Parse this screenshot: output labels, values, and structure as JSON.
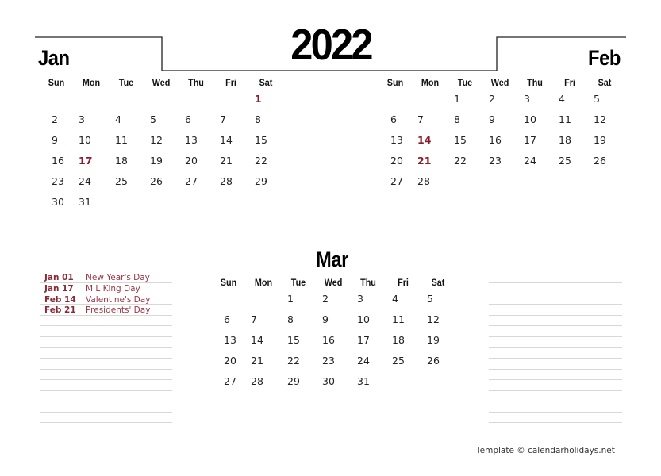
{
  "year": "2022",
  "weekdays": [
    "Sun",
    "Mon",
    "Tue",
    "Wed",
    "Thu",
    "Fri",
    "Sat"
  ],
  "months": [
    {
      "name": "Jan",
      "weeks": [
        [
          "",
          "",
          "",
          "",
          "",
          "",
          "1"
        ],
        [
          "2",
          "3",
          "4",
          "5",
          "6",
          "7",
          "8"
        ],
        [
          "9",
          "10",
          "11",
          "12",
          "13",
          "14",
          "15"
        ],
        [
          "16",
          "17",
          "18",
          "19",
          "20",
          "21",
          "22"
        ],
        [
          "23",
          "24",
          "25",
          "26",
          "27",
          "28",
          "29"
        ],
        [
          "30",
          "31",
          "",
          "",
          "",
          "",
          ""
        ]
      ],
      "holidays": [
        "1",
        "17"
      ]
    },
    {
      "name": "Feb",
      "weeks": [
        [
          "",
          "",
          "1",
          "2",
          "3",
          "4",
          "5"
        ],
        [
          "6",
          "7",
          "8",
          "9",
          "10",
          "11",
          "12"
        ],
        [
          "13",
          "14",
          "15",
          "16",
          "17",
          "18",
          "19"
        ],
        [
          "20",
          "21",
          "22",
          "23",
          "24",
          "25",
          "26"
        ],
        [
          "27",
          "28",
          "",
          "",
          "",
          "",
          ""
        ]
      ],
      "holidays": [
        "14",
        "21"
      ]
    },
    {
      "name": "Mar",
      "weeks": [
        [
          "",
          "",
          "1",
          "2",
          "3",
          "4",
          "5"
        ],
        [
          "6",
          "7",
          "8",
          "9",
          "10",
          "11",
          "12"
        ],
        [
          "13",
          "14",
          "15",
          "16",
          "17",
          "18",
          "19"
        ],
        [
          "20",
          "21",
          "22",
          "23",
          "24",
          "25",
          "26"
        ],
        [
          "27",
          "28",
          "29",
          "30",
          "31",
          "",
          ""
        ]
      ],
      "holidays": []
    }
  ],
  "holiday_list": [
    {
      "date": "Jan 01",
      "name": "New Year's Day"
    },
    {
      "date": "Jan 17",
      "name": "M L King Day"
    },
    {
      "date": "Feb 14",
      "name": "Valentine's Day"
    },
    {
      "date": "Feb 21",
      "name": "Presidents' Day"
    }
  ],
  "colors": {
    "holiday": "#8b1c2c",
    "rule_line": "#d8d8d8"
  },
  "footer": "Template © calendarholidays.net"
}
